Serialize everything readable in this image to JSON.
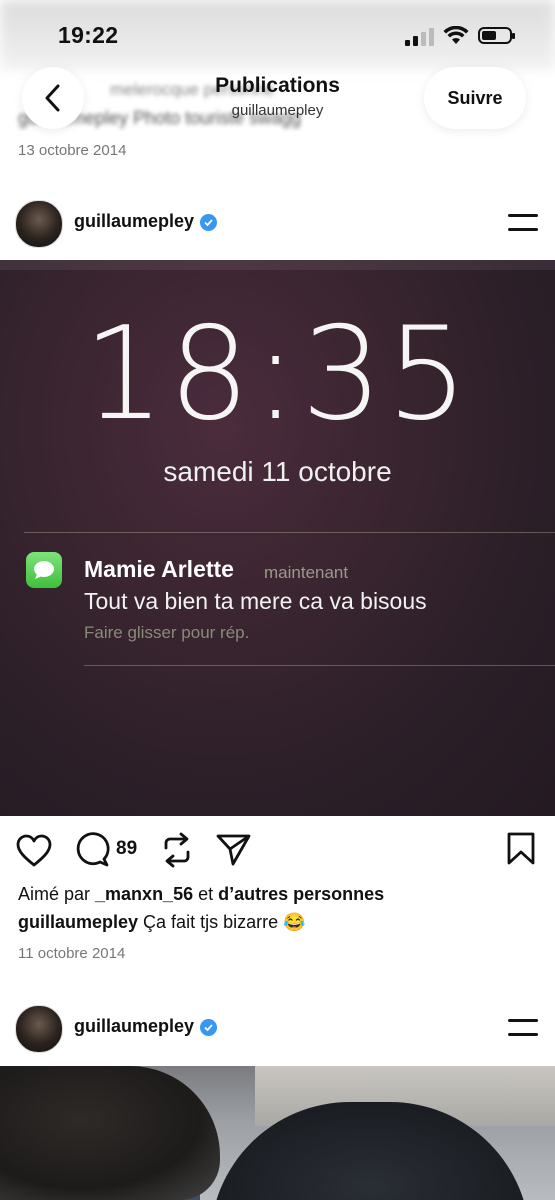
{
  "status_bar": {
    "time": "19:22"
  },
  "header": {
    "title": "Publications",
    "subtitle": "guillaumepley",
    "follow_label": "Suivre"
  },
  "previous_post": {
    "blurred_text_1": "melerocque personne",
    "blurred_text_2": "guillaumepley Photo touriste swagg",
    "date": "13 octobre 2014"
  },
  "post": {
    "username": "guillaumepley",
    "photo": {
      "lock_time": "18:35",
      "lock_date": "samedi 11 octobre",
      "notification": {
        "sender": "Mamie Arlette",
        "when": "maintenant",
        "message": "Tout va bien ta mere ca va bisous",
        "hint": "Faire glisser pour rép."
      }
    },
    "comment_count": "89",
    "likes_prefix": "Aimé par ",
    "likes_user": "_manxn_56",
    "likes_middle": " et ",
    "likes_others": "d’autres personnes",
    "caption_user": "guillaumepley",
    "caption_text": " Ça fait tjs bizarre 😂",
    "date": "11 octobre 2014"
  },
  "next_post": {
    "username": "guillaumepley"
  },
  "colors": {
    "verified": "#3897f0",
    "text": "#111111",
    "muted": "#777777"
  }
}
